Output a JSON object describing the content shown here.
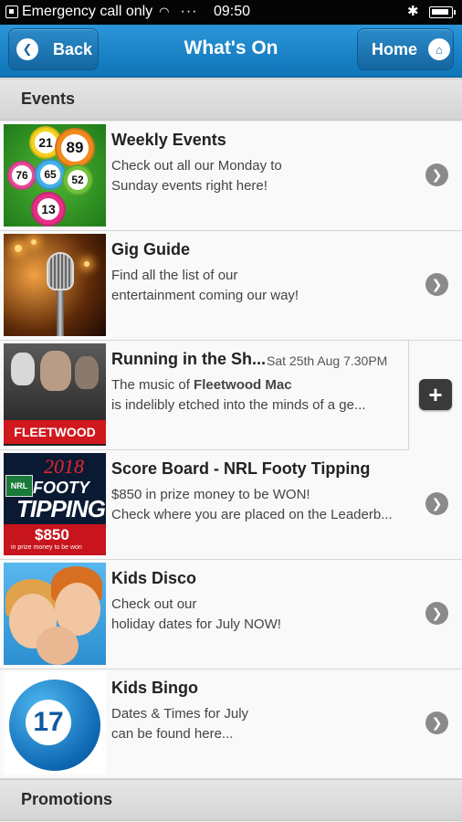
{
  "status_bar": {
    "carrier_text": "Emergency call only",
    "dots": "···",
    "time": "09:50"
  },
  "header": {
    "title": "What's On",
    "back_label": "Back",
    "home_label": "Home"
  },
  "sections": {
    "events": "Events",
    "promotions": "Promotions"
  },
  "items": [
    {
      "title": "Weekly Events",
      "line1": "Check out all our Monday to",
      "line2": "Sunday events right here!"
    },
    {
      "title": "Gig Guide",
      "line1": "Find all the list of our",
      "line2": "entertainment coming our way!"
    },
    {
      "title": "Running in the Sh...",
      "date": "Sat 25th Aug 7.30PM",
      "line1_prefix": "The music of ",
      "line1_bold": "Fleetwood Mac",
      "line2": "is indelibly etched into the minds of a ge..."
    },
    {
      "title": "Score Board - NRL Footy Tipping",
      "line1": "$850 in prize money to be WON!",
      "line2": "Check where you are placed on the Leaderb..."
    },
    {
      "title": "Kids Disco",
      "line1": "Check out our",
      "line2": "holiday dates for July NOW!"
    },
    {
      "title": "Kids Bingo",
      "line1": "Dates & Times for July",
      "line2": "can be found here..."
    }
  ],
  "thumbs": {
    "bingo_balls": [
      "21",
      "89",
      "76",
      "65",
      "52",
      "13"
    ],
    "fleetwood_banner": "FLEETWOOD MAC",
    "nrl": {
      "year": "2018",
      "badge": "NRL",
      "footy": "FOOTY",
      "tipping": "TIPPING",
      "price": "$850",
      "sub": "in prize money to be won"
    },
    "kids_bingo_number": "17"
  },
  "colors": {
    "header": "#1a7fc4",
    "accent_red": "#d0181e"
  },
  "icons": [
    "chevron-left-icon",
    "home-icon",
    "chevron-right-icon",
    "plus-icon"
  ]
}
